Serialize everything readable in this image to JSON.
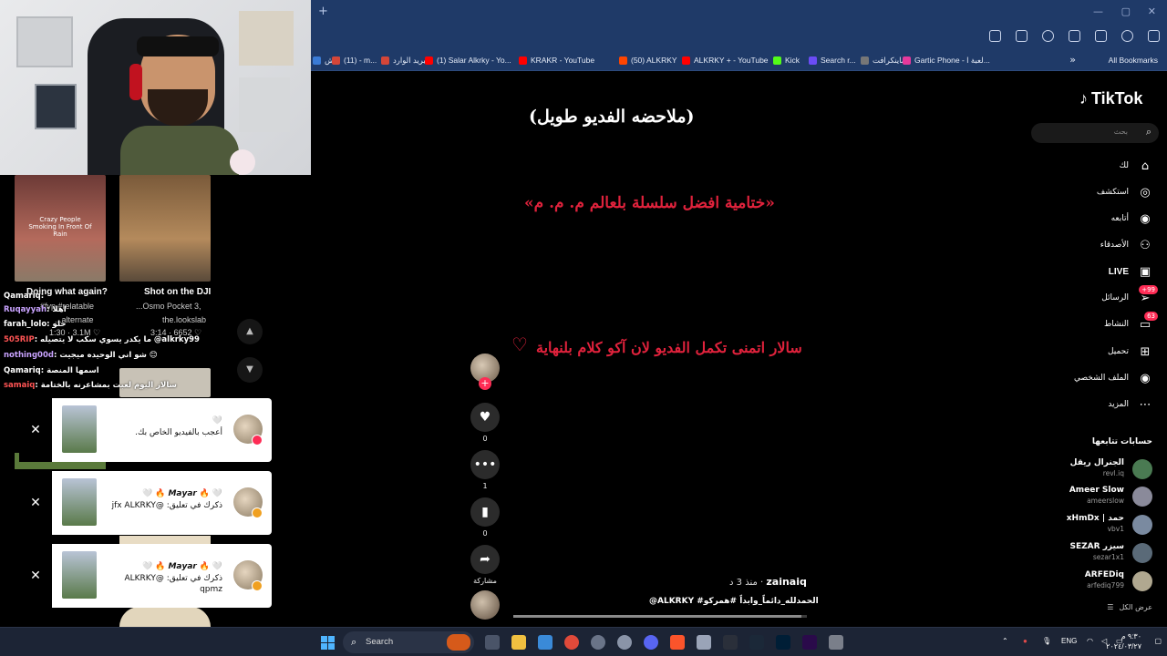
{
  "browser": {
    "bookmarks": [
      {
        "label": "الاش",
        "color": "#3a7bd5"
      },
      {
        "label": "(11) - m...",
        "color": "#d44638"
      },
      {
        "label": "البريد الوارد",
        "color": "#d44638"
      },
      {
        "label": "(1) Salar Alkrky - Yo...",
        "color": "#ff0000"
      },
      {
        "label": "KRAKR - YouTube",
        "color": "#ff0000"
      },
      {
        "label": "(50) ALKRKY",
        "color": "#ff4500"
      },
      {
        "label": "ALKRKY + - YouTube",
        "color": "#ff0000"
      },
      {
        "label": "Kick",
        "color": "#53fc18"
      },
      {
        "label": "Search r...",
        "color": "#6b4cf5"
      },
      {
        "label": "ماينكرافت -",
        "color": "#777777"
      },
      {
        "label": "Gartic Phone - لعبة ا...",
        "color": "#e6399b"
      }
    ],
    "all_bookmarks": "All Bookmarks"
  },
  "video": {
    "caption_note": "(ملاحضه الفديو طويل)",
    "caption_title": "«ختامية افضل سلسلة بلعالم م. م. م»",
    "caption_wish": "سالار اتمنى تكمل الفديو لان آكو كلام بلنهاية",
    "heart": "♡",
    "author": "zainaiq",
    "time_ago": "منذ 3 د",
    "description": "@ALKRKY #الحمدلله_دائماً_وابداً #همركو",
    "progress": 0.98,
    "actions": {
      "likes": "0",
      "comments": "1",
      "saves": "0",
      "share": "مشاركة"
    }
  },
  "tiktok": {
    "logo": "TikTok",
    "search_placeholder": "بحث",
    "nav": [
      {
        "label": "لك",
        "icon": "home-icon"
      },
      {
        "label": "استكشف",
        "icon": "compass-icon"
      },
      {
        "label": "أتابعه",
        "icon": "avatar-icon"
      },
      {
        "label": "الأصدقاء",
        "icon": "friends-icon"
      },
      {
        "label": "LIVE",
        "icon": "live-icon"
      },
      {
        "label": "الرسائل",
        "icon": "messages-icon",
        "badge": "99+"
      },
      {
        "label": "النشاط",
        "icon": "activity-icon",
        "badge": "63"
      },
      {
        "label": "تحميل",
        "icon": "upload-icon"
      },
      {
        "label": "الملف الشخصي",
        "icon": "profile-icon"
      },
      {
        "label": "المزيد",
        "icon": "more-icon"
      }
    ],
    "following_title": "حسابات تتابعها",
    "following": [
      {
        "name": "الجنرال ريقل",
        "user": "revl.iq",
        "color": "#4a7a52"
      },
      {
        "name": "Ameer Slow",
        "user": "ameerslow",
        "color": "#8a8a9a"
      },
      {
        "name": "xHmDx | حمد",
        "user": "vbv1",
        "color": "#7a8aa0"
      },
      {
        "name": "SEZAR سيزر",
        "user": "sezar1x1",
        "color": "#5a6a78"
      },
      {
        "name": "ARFEDiq",
        "user": "arfediq799",
        "color": "#b0a890"
      }
    ],
    "see_all": "عرض الكل"
  },
  "stream": {
    "thumbs": [
      {
        "title": "Doing what again?",
        "sub": "#fyp #relatable",
        "sub2": "...alternate",
        "meta": "1:30 · 3.1M ♡",
        "overlay": "Crazy People Smoking In Front Of Rain"
      },
      {
        "title": "Shot on the DJI",
        "sub": "...Osmo Pocket 3,",
        "sub2": "the.lookslab",
        "meta": "3:14 · 6652 ♡"
      }
    ],
    "chat": [
      {
        "user": "Qamariq",
        "text": ":"
      },
      {
        "user": "Ruqayyah",
        "text": ": اهلا"
      },
      {
        "user": "farah_lolo",
        "text": ": حلو"
      },
      {
        "user": "505RIP",
        "text": ": ما يكدر يسوي سكب لا يتصيله @alkrky99"
      },
      {
        "user": "nothing00d",
        "text": ": شو اني الوحيده ميجيت 😊"
      },
      {
        "user": "Qamariq",
        "text": ": اسمها المنصة"
      },
      {
        "user": "samaiq",
        "text": ": سالار اليوم لعبت بمشاعرنه بالختامة"
      }
    ],
    "notifications": [
      {
        "line1": "🤍",
        "line2": "أعجب بالفيديو الخاص بك.",
        "line3": ""
      },
      {
        "line1": "🤍 🔥 𝙈𝙖𝙮𝙖𝙧 🔥 🤍",
        "line2": "ذكرك في تعليق: @jfx ALKRKY",
        "line3": ""
      },
      {
        "line1": "🤍 🔥 𝙈𝙖𝙮𝙖𝙧 🔥 🤍",
        "line2": "ذكرك في تعليق: @ALKRKY",
        "line3": "qpmz"
      }
    ]
  },
  "taskbar": {
    "search": "Search",
    "lang": "ENG",
    "time": "٩:٣٠ م",
    "date": "٢٠٢٤/٠٣/٢٧"
  }
}
